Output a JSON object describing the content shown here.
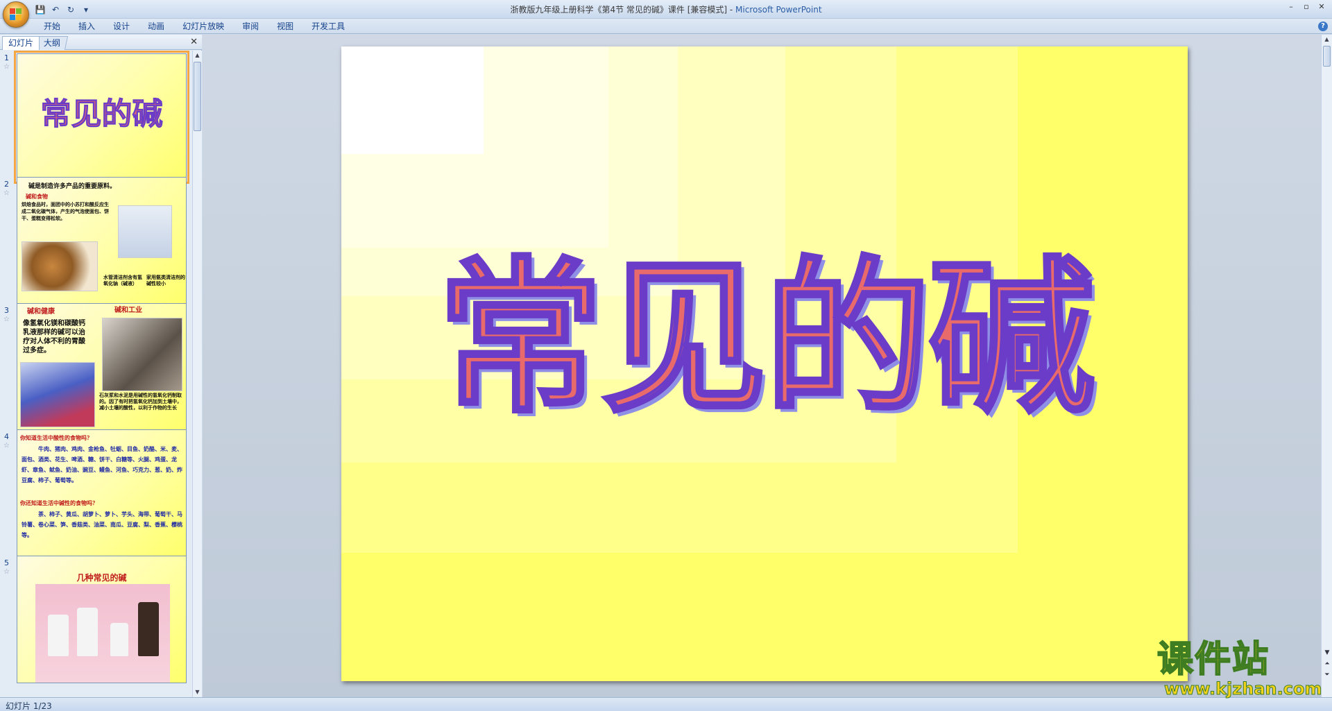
{
  "window": {
    "title": "浙教版九年级上册科学《第4节 常见的碱》课件 [兼容模式] - ",
    "app_name": "Microsoft PowerPoint",
    "controls": {
      "minimize": "–",
      "restore": "▫",
      "close": "✕"
    }
  },
  "quick_access": {
    "save_icon": "💾",
    "undo_icon": "↶",
    "redo_icon": "↻",
    "customize_icon": "▾"
  },
  "ribbon": {
    "tabs": [
      "开始",
      "插入",
      "设计",
      "动画",
      "幻灯片放映",
      "审阅",
      "视图",
      "开发工具"
    ],
    "help": "?"
  },
  "left_pane": {
    "tabs": {
      "slides": "幻灯片",
      "outline": "大纲"
    },
    "close": "✕",
    "thumbnails": [
      {
        "num": "1",
        "title": "常见的碱"
      },
      {
        "num": "2",
        "heading": "碱是制造许多产品的重要原料。",
        "sub": "碱和食物",
        "body": "烘焙食品时，面团中的小苏打和酸反应生成二氧化碳气体，产生的气泡使面包、饼干、蛋糕变得松软。",
        "cap1": "水管清洁剂含有氢氧化钠（碱液）",
        "cap2": "家用氨类清洁剂的碱性较小"
      },
      {
        "num": "3",
        "sub1": "碱和健康",
        "sub2": "碱和工业",
        "body": "像氢氧化镁和碳酸钙乳液那样的碱可以治疗对人体不利的胃酸过多症。",
        "cap": "石灰浆和水泥是用碱性的氢氧化钙制取的。因了有时把氢氧化钙加到土壤中，减小土壤的酸性，以利于作物的生长"
      },
      {
        "num": "4",
        "q1": "你知道生活中酸性的食物吗？",
        "a1": "牛肉、猪肉、鸡肉、金枪鱼、牡蛎、目鱼、奶酪、米、麦、面包、酒类、花生、啤酒、糖、饼干、白糖等、火腿、鸡蛋、龙虾、章鱼、鱿鱼、奶油、豌豆、鳗鱼、河鱼、巧克力、葱、奶、炸豆腐、柿子、葡萄等。",
        "q2": "你还知道生活中碱性的食物吗？",
        "a2": "茶、柿子、黄瓜、胡萝卜、萝卜、芋头、海带、葡萄干、马铃薯、卷心菜、笋、香菇类、油菜、南瓜、豆腐、梨、香蕉、樱桃等。"
      },
      {
        "num": "5",
        "title": "几种常见的碱"
      }
    ]
  },
  "slide": {
    "title": "常见的碱"
  },
  "status": {
    "slide_counter": "幻灯片 1/23"
  },
  "watermark": {
    "brand": "课件站",
    "url": "www.kjzhan.com"
  }
}
